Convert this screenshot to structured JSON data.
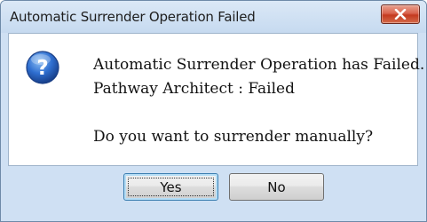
{
  "dialog": {
    "title": "Automatic Surrender Operation Failed",
    "icon": "question-icon",
    "message_lines": [
      "Automatic Surrender Operation has Failed.",
      "Pathway Architect : Failed",
      "",
      "Do you want to surrender manually?"
    ],
    "buttons": {
      "yes": "Yes",
      "no": "No"
    },
    "close_icon": "close-icon"
  },
  "colors": {
    "close_button": "#c43a20",
    "icon_blue": "#2b5fb8",
    "frame": "#cfe0f3"
  }
}
